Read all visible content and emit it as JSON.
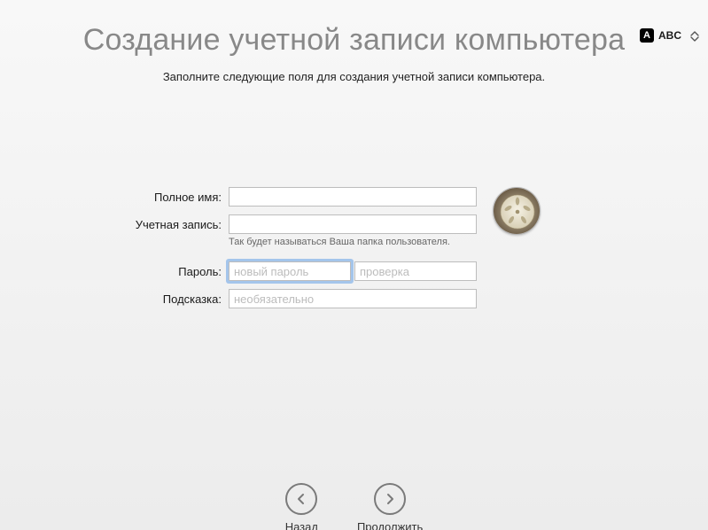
{
  "menubar": {
    "input_badge": "A",
    "input_label": "ABC"
  },
  "title": "Создание учетной записи компьютера",
  "subtitle": "Заполните следующие поля для создания учетной записи компьютера.",
  "form": {
    "full_name_label": "Полное имя:",
    "full_name_value": "",
    "account_label": "Учетная запись:",
    "account_value": "",
    "account_helper": "Так будет называться Ваша папка пользователя.",
    "password_label": "Пароль:",
    "password_placeholder": "новый пароль",
    "password_value": "",
    "verify_placeholder": "проверка",
    "verify_value": "",
    "hint_label": "Подсказка:",
    "hint_placeholder": "необязательно",
    "hint_value": ""
  },
  "avatar": {
    "name": "sand-dollar"
  },
  "footer": {
    "back_label": "Назад",
    "continue_label": "Продолжить"
  }
}
